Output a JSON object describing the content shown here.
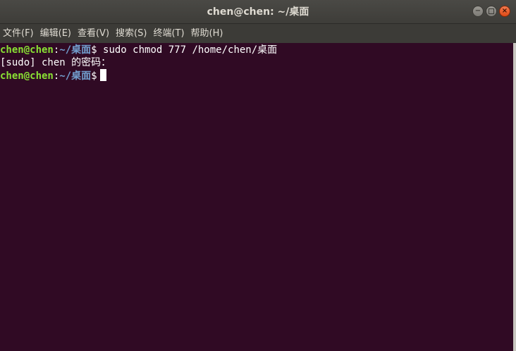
{
  "window": {
    "title": "chen@chen: ~/桌面"
  },
  "menu": {
    "items": [
      "文件(F)",
      "编辑(E)",
      "查看(V)",
      "搜索(S)",
      "终端(T)",
      "帮助(H)"
    ]
  },
  "terminal": {
    "prompt_user": "chen@chen",
    "prompt_sep": ":",
    "prompt_path": "~/桌面",
    "prompt_symbol": "$",
    "line1_command": " sudo chmod 777 /home/chen/桌面",
    "line2_text": "[sudo] chen 的密码："
  },
  "colors": {
    "terminal_bg": "#300a24",
    "prompt_user": "#8ae234",
    "prompt_path": "#729fcf",
    "close_button": "#df4a16"
  },
  "icons": {
    "minimize": "minimize-icon",
    "maximize": "maximize-icon",
    "close": "close-icon"
  }
}
